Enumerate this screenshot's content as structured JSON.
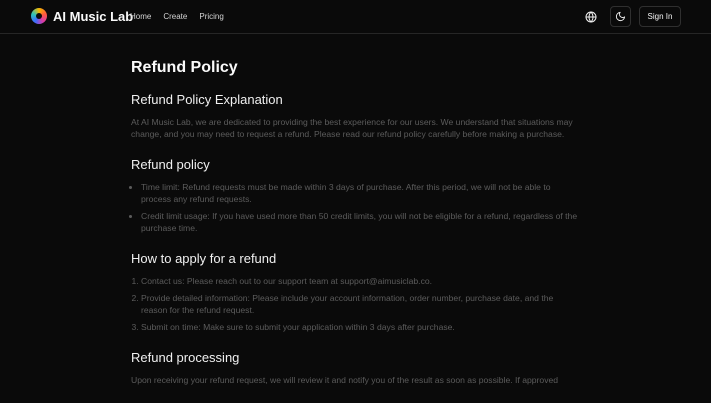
{
  "header": {
    "brand": "AI Music Lab",
    "nav": [
      "Home",
      "Create",
      "Pricing"
    ],
    "signin_label": "Sign In"
  },
  "page": {
    "title": "Refund Policy",
    "sections": [
      {
        "heading": "Refund Policy Explanation",
        "paragraph": "At AI Music Lab, we are dedicated to providing the best experience for our users. We understand that situations may change, and you may need to request a refund. Please read our refund policy carefully before making a purchase."
      },
      {
        "heading": "Refund policy",
        "bullets": [
          "Time limit: Refund requests must be made within 3 days of purchase. After this period, we will not be able to process any refund requests.",
          "Credit limit usage: If you have used more than 50 credit limits, you will not be eligible for a refund, regardless of the purchase time."
        ]
      },
      {
        "heading": "How to apply for a refund",
        "steps": [
          "Contact us: Please reach out to our support team at support@aimusiclab.co.",
          "Provide detailed information: Please include your account information, order number, purchase date, and the reason for the refund request.",
          "Submit on time: Make sure to submit your application within 3 days after purchase."
        ]
      },
      {
        "heading": "Refund processing",
        "paragraph": "Upon receiving your refund request, we will review it and notify you of the result as soon as possible. If approved"
      }
    ]
  },
  "icons": {
    "language": "globe-icon",
    "theme": "moon-icon",
    "logo": "music-logo"
  }
}
